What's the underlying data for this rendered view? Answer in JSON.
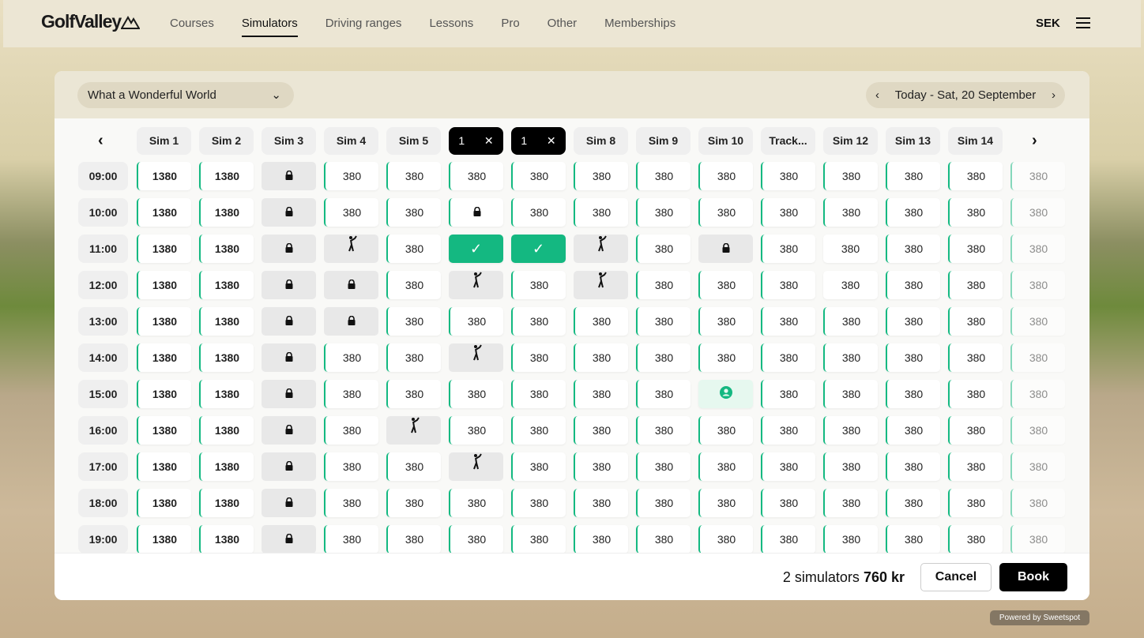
{
  "header": {
    "logo": "GolfValley",
    "nav": [
      {
        "label": "Courses"
      },
      {
        "label": "Simulators",
        "active": true
      },
      {
        "label": "Driving ranges"
      },
      {
        "label": "Lessons"
      },
      {
        "label": "Pro"
      },
      {
        "label": "Other"
      },
      {
        "label": "Memberships"
      }
    ],
    "currency": "SEK"
  },
  "toolbar": {
    "venue": "What a Wonderful World",
    "date": "Today - Sat, 20 September"
  },
  "columns": [
    {
      "label": "Sim 1"
    },
    {
      "label": "Sim 2"
    },
    {
      "label": "Sim 3"
    },
    {
      "label": "Sim 4"
    },
    {
      "label": "Sim 5"
    },
    {
      "label": "1",
      "selected": true
    },
    {
      "label": "1",
      "selected": true
    },
    {
      "label": "Sim 8"
    },
    {
      "label": "Sim 9"
    },
    {
      "label": "Sim 10"
    },
    {
      "label": "Track..."
    },
    {
      "label": "Sim 12"
    },
    {
      "label": "Sim 13"
    },
    {
      "label": "Sim 14"
    },
    {
      "label": ""
    }
  ],
  "rows": [
    {
      "time": "09:00",
      "cells": [
        "1380",
        "1380",
        "lock",
        "380",
        "380",
        "380",
        "380",
        "380",
        "380",
        "380",
        "380",
        "380",
        "380",
        "380",
        "380"
      ]
    },
    {
      "time": "10:00",
      "cells": [
        "1380",
        "1380",
        "lock",
        "380",
        "380",
        "lock-available",
        "380",
        "380",
        "380",
        "380",
        "380",
        "380",
        "380",
        "380",
        "380"
      ]
    },
    {
      "time": "11:00",
      "cells": [
        "1380",
        "1380",
        "lock",
        "golfer",
        "380",
        "selected",
        "selected",
        "golfer",
        "380",
        "lock",
        "380",
        "380-unavailable",
        "380",
        "380",
        "380"
      ]
    },
    {
      "time": "12:00",
      "cells": [
        "1380",
        "1380",
        "lock",
        "lock",
        "380",
        "golfer",
        "380",
        "golfer",
        "380",
        "380",
        "380",
        "380-unavailable",
        "380",
        "380",
        "380"
      ]
    },
    {
      "time": "13:00",
      "cells": [
        "1380",
        "1380",
        "lock",
        "lock",
        "380",
        "380",
        "380",
        "380",
        "380",
        "380",
        "380",
        "380",
        "380",
        "380",
        "380"
      ]
    },
    {
      "time": "14:00",
      "cells": [
        "1380",
        "1380",
        "lock",
        "380",
        "380",
        "golfer",
        "380",
        "380",
        "380",
        "380",
        "380",
        "380",
        "380",
        "380",
        "380"
      ]
    },
    {
      "time": "15:00",
      "cells": [
        "1380",
        "1380",
        "lock",
        "380",
        "380",
        "380",
        "380",
        "380",
        "380",
        "user",
        "380",
        "380",
        "380",
        "380",
        "380"
      ]
    },
    {
      "time": "16:00",
      "cells": [
        "1380",
        "1380",
        "lock",
        "380",
        "golfer",
        "380",
        "380",
        "380",
        "380",
        "380",
        "380",
        "380",
        "380",
        "380",
        "380"
      ]
    },
    {
      "time": "17:00",
      "cells": [
        "1380",
        "1380",
        "lock",
        "380",
        "380",
        "golfer",
        "380",
        "380",
        "380",
        "380",
        "380",
        "380",
        "380",
        "380",
        "380"
      ]
    },
    {
      "time": "18:00",
      "cells": [
        "1380",
        "1380",
        "lock",
        "380",
        "380",
        "380",
        "380",
        "380",
        "380",
        "380",
        "380",
        "380",
        "380",
        "380",
        "380"
      ]
    },
    {
      "time": "19:00",
      "cells": [
        "1380",
        "1380",
        "lock",
        "380",
        "380",
        "380",
        "380",
        "380",
        "380",
        "380",
        "380",
        "380",
        "380",
        "380",
        "380"
      ]
    }
  ],
  "footer": {
    "count": "2 simulators",
    "total": "760 kr",
    "cancel": "Cancel",
    "book": "Book"
  },
  "powered": "Powered by Sweetspot",
  "colors": {
    "accent": "#13b981",
    "header_bg": "#ece6d4"
  }
}
